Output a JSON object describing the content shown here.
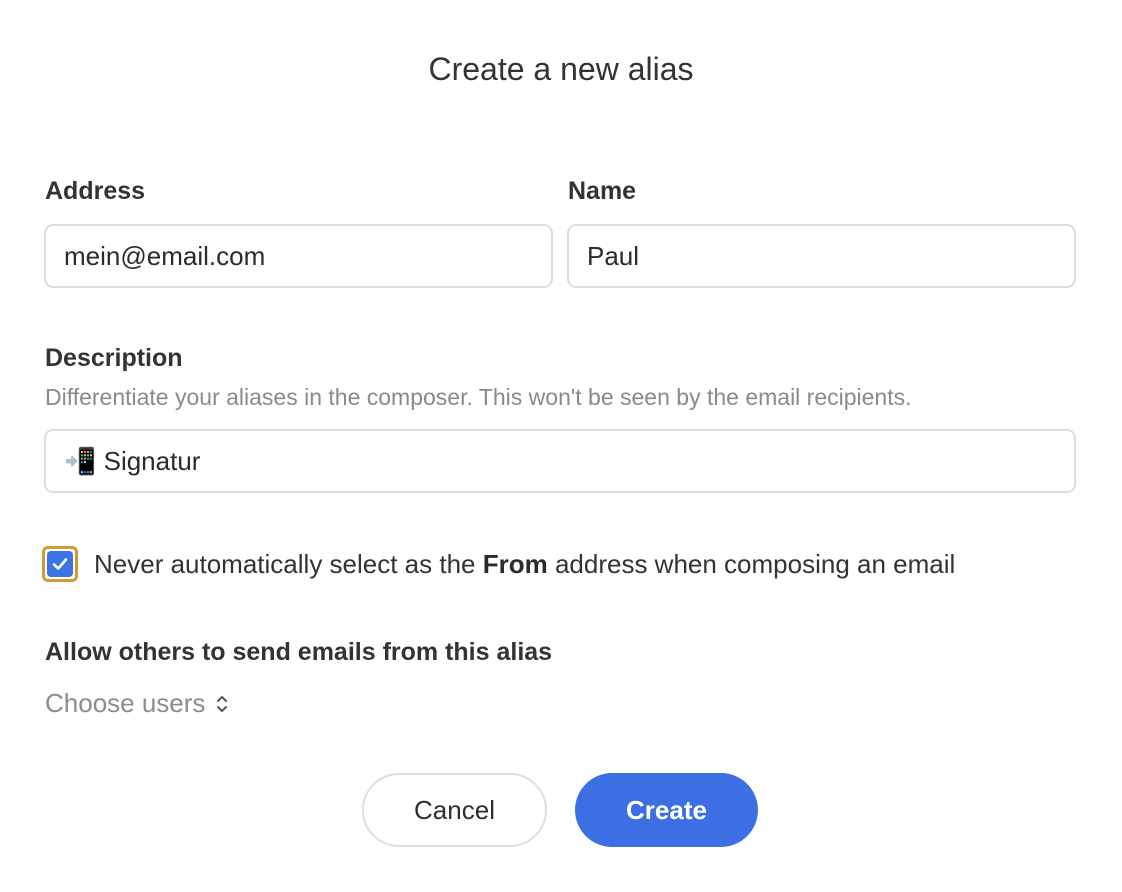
{
  "dialog": {
    "title": "Create a new alias"
  },
  "address": {
    "label": "Address",
    "value": "mein@email.com"
  },
  "name": {
    "label": "Name",
    "value": "Paul"
  },
  "description": {
    "label": "Description",
    "hint": "Differentiate your aliases in the composer. This won't be seen by the email recipients.",
    "value": "📲 Signatur"
  },
  "never_auto_select": {
    "checked": true,
    "text_before": "Never automatically select as the ",
    "text_bold": "From",
    "text_after": " address when composing an email"
  },
  "allow_others": {
    "label": "Allow others to send emails from this alias",
    "picker_label": "Choose users",
    "picker_icon": "chevron-up-down-icon"
  },
  "buttons": {
    "cancel_label": "Cancel",
    "create_label": "Create"
  },
  "colors": {
    "primary": "#3c6fe3",
    "focus_ring": "#d59a2e",
    "checkbox_fill": "#3a74e6"
  }
}
